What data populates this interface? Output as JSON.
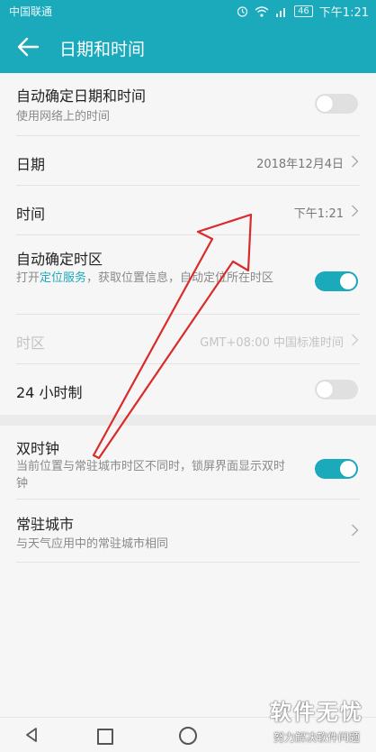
{
  "status_bar": {
    "carrier": "中国联通",
    "battery": "46",
    "time": "下午1:21",
    "icons": [
      "alarm-icon",
      "wifi-icon",
      "signal-icon",
      "battery-icon"
    ]
  },
  "app_bar": {
    "title": "日期和时间",
    "back_icon": "arrow-left-icon"
  },
  "settings": {
    "auto_datetime": {
      "label": "自动确定日期和时间",
      "sub": "使用网络上的时间",
      "enabled": false
    },
    "date": {
      "label": "日期",
      "value": "2018年12月4日"
    },
    "time": {
      "label": "时间",
      "value": "下午1:21"
    },
    "auto_timezone": {
      "label": "自动确定时区",
      "sub_prefix": "打开",
      "sub_link": "定位服务",
      "sub_suffix": "，获取位置信息，自动定位所在时区",
      "enabled": true
    },
    "timezone": {
      "label": "时区",
      "value": "GMT+08:00 中国标准时间",
      "disabled": true
    },
    "hour24": {
      "label": "24 小时制",
      "enabled": false
    },
    "dual_clock": {
      "label": "双时钟",
      "sub": "当前位置与常驻城市时区不同时，锁屏界面显示双时钟",
      "enabled": true
    },
    "home_city": {
      "label": "常驻城市",
      "sub": "与天气应用中的常驻城市相同"
    }
  },
  "watermark": {
    "main": "软件无忧",
    "sub": "努力解决软件问题"
  },
  "colors": {
    "accent": "#1aaabb",
    "annotation": "#d92b2b",
    "background": "#f6f6f6"
  }
}
